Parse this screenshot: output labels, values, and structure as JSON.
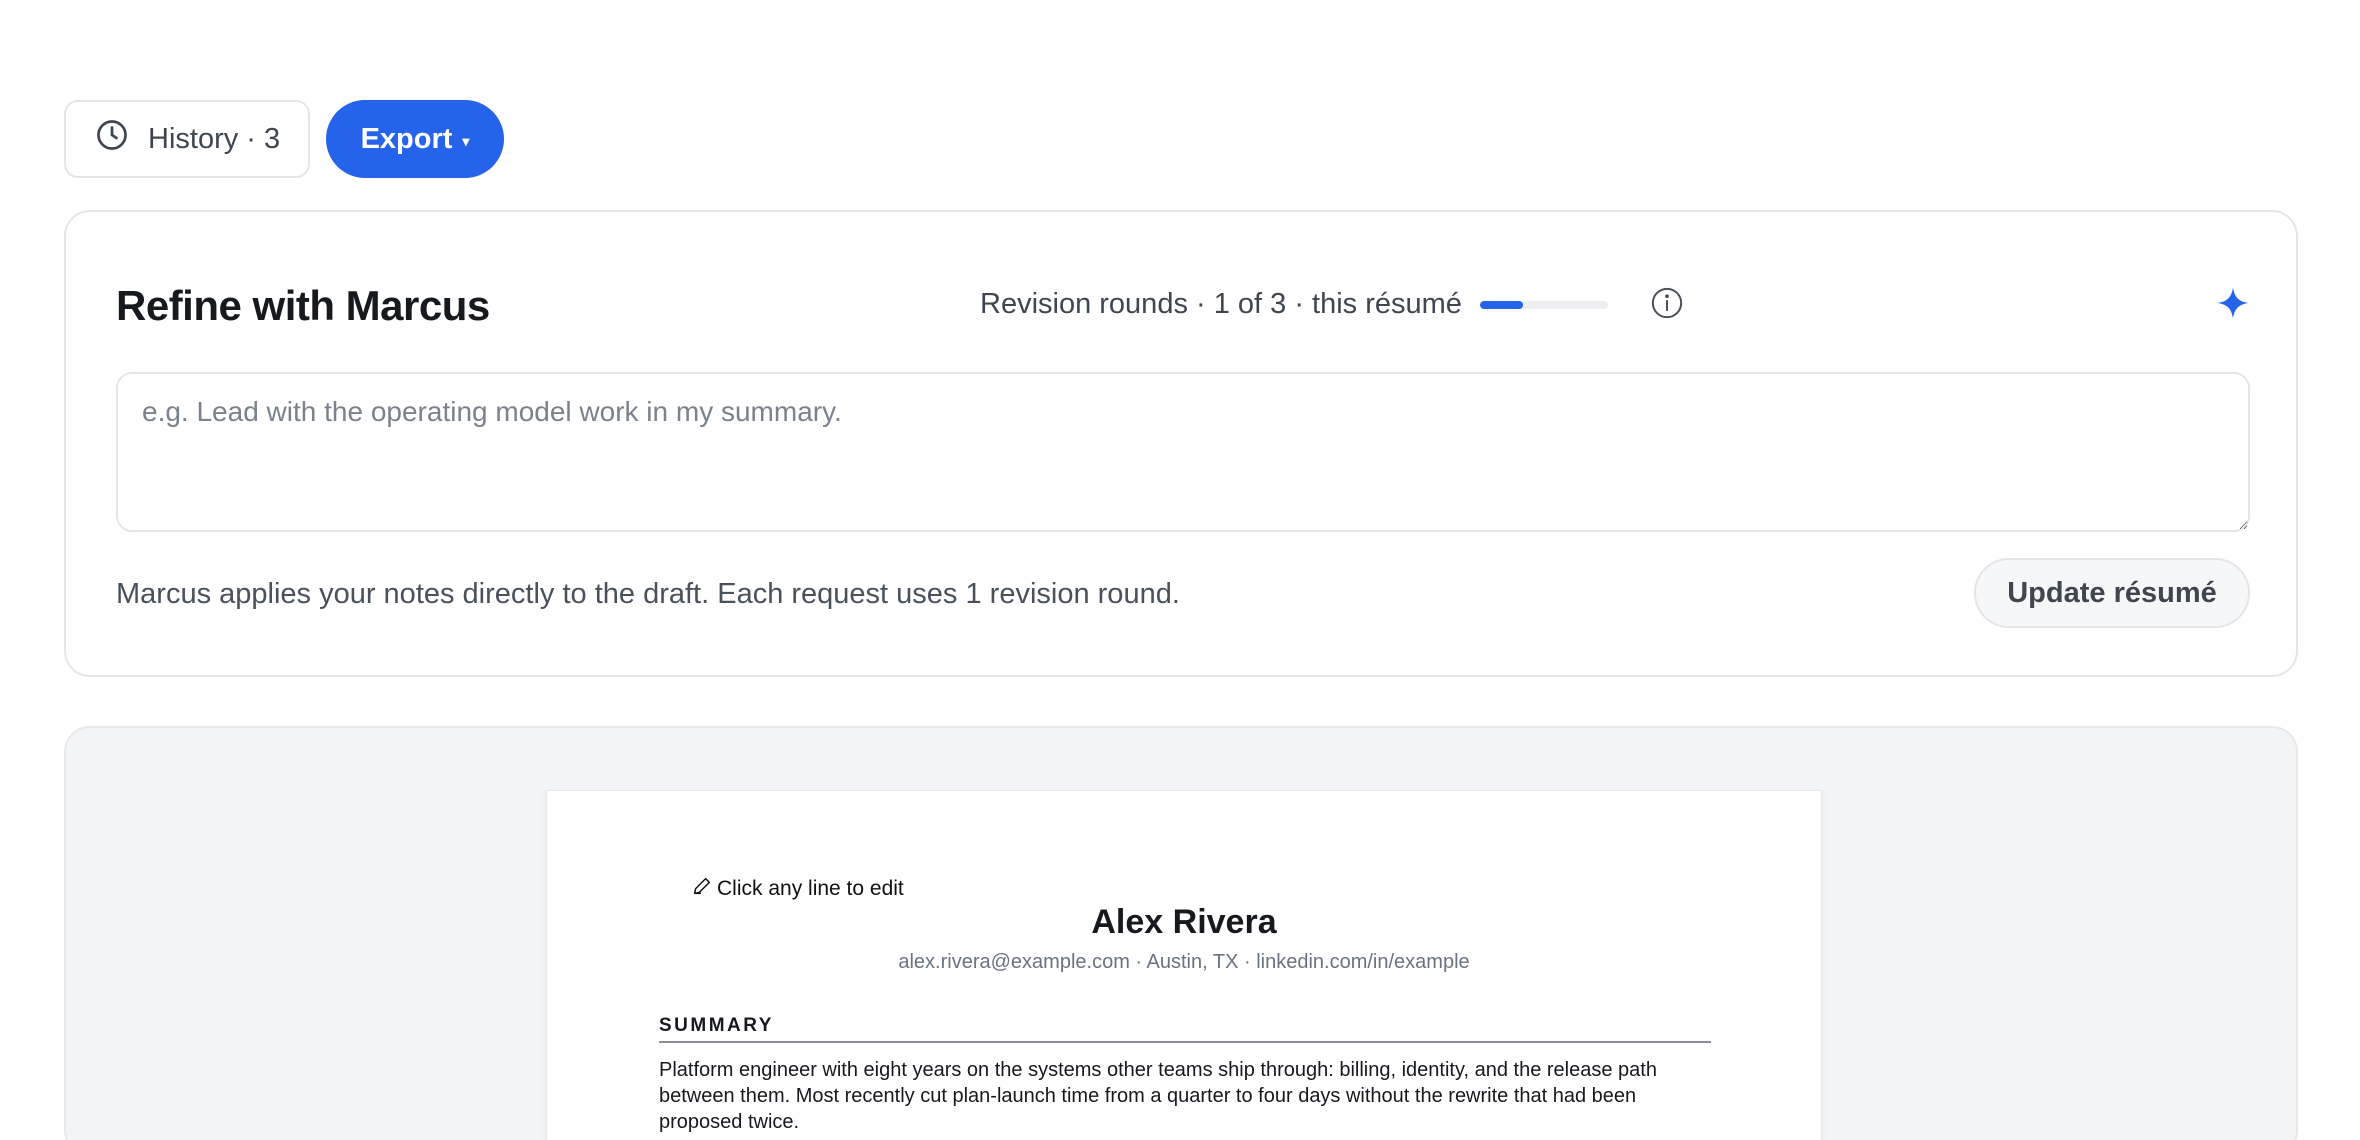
{
  "toolbar": {
    "history_label": "History · 3",
    "export_label": "Export",
    "export_caret": "▾",
    "accent_color": "#2563eb"
  },
  "refine": {
    "title": "Refine with Marcus",
    "rounds_text": "Revision rounds · 1 of 3 · this résumé",
    "rounds_used": 1,
    "rounds_total": 3,
    "input_placeholder": "e.g. Lead with the operating model work in my summary.",
    "input_value": "",
    "note": "Marcus applies your notes directly to the draft. Each request uses 1 revision round.",
    "update_label": "Update résumé",
    "icons": [
      "info-icon",
      "sparkle-icon",
      "clock-icon"
    ]
  },
  "resume": {
    "edit_hint": "Click any line to edit",
    "name": "Alex Rivera",
    "contact": "alex.rivera@example.com · Austin, TX · linkedin.com/in/example",
    "summary_heading": "SUMMARY",
    "summary_text": "Platform engineer with eight years on the systems other teams ship through: billing, identity, and the release path between them. Most recently cut plan-launch time from a quarter to four days without the rewrite that had been proposed twice."
  }
}
